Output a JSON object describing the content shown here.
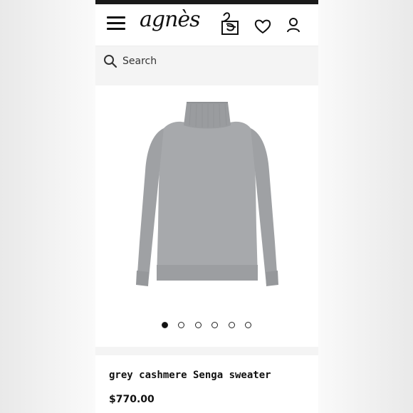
{
  "header": {
    "logo_text": "agnès",
    "menu_icon": "hamburger-menu-icon",
    "bag_icon": "shopping-bag-icon",
    "wishlist_icon": "heart-icon",
    "account_icon": "user-icon"
  },
  "search": {
    "placeholder": "Search",
    "icon": "search-icon"
  },
  "gallery": {
    "image_alt": "grey turtleneck sweater",
    "dot_count": 6,
    "active_index": 0
  },
  "product": {
    "name": "grey cashmere Senga sweater",
    "price": "$770.00"
  },
  "colors": {
    "text": "#111111",
    "background": "#f4f4f4",
    "sweater": "#a7a9ac"
  }
}
